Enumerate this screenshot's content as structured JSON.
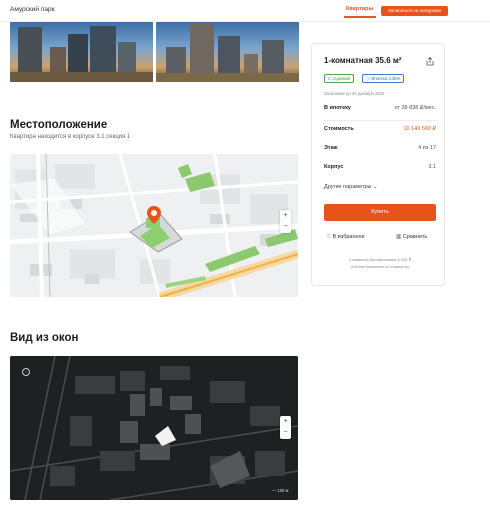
{
  "header": {
    "brand": "Амурский парк",
    "nav_flats": "Квартиры",
    "tour_button": "Записаться на экскурсию"
  },
  "location": {
    "title": "Местоположение",
    "subtitle": "Квартира находится в корпусе 3.1 секция 1",
    "zoom_in": "+",
    "zoom_out": "−"
  },
  "view": {
    "title": "Вид из окон",
    "zoom_in": "+",
    "zoom_out": "−",
    "scale": "100 м"
  },
  "card": {
    "title": "1-комнатная 35.6 м²",
    "badge_finish": "С отделкой",
    "badge_mortgage": "Ипотека 3,35%",
    "settlement": "Заселение до 30 декабря 2022",
    "mortgage_label": "В ипотеку",
    "mortgage_value": "от 38 838 ₽/мес.",
    "price_label": "Стоимость",
    "price_value": "10 149 560 ₽",
    "floor_label": "Этаж",
    "floor_value": "4 из 17",
    "building_label": "Корпус",
    "building_value": "3.1",
    "more_params": "Другие параметры",
    "buy_button": "Купить",
    "favorite": "В избранное",
    "compare": "Сравнить",
    "foot_line1": "Стоимость бронирования 5 000 ₽",
    "foot_line2": "(Оплата включена в стоимость)"
  },
  "colors": {
    "accent": "#e8531b",
    "price": "#e05a20",
    "green_badge": "#3b8c44",
    "blue_badge": "#2f67c4"
  }
}
